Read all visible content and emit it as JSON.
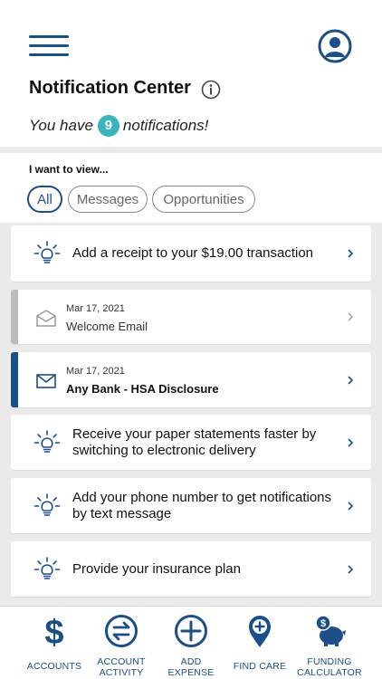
{
  "header": {
    "title": "Notification Center",
    "subtitle_prefix": "You have",
    "count": "9",
    "subtitle_suffix": "notifications!"
  },
  "filter": {
    "label": "I want to view...",
    "chips": [
      {
        "label": "All",
        "active": true
      },
      {
        "label": "Messages",
        "active": false
      },
      {
        "label": "Opportunities",
        "active": false
      }
    ]
  },
  "notifications": [
    {
      "type": "opportunity",
      "text": "Add a receipt to your $19.00 transaction"
    },
    {
      "type": "message",
      "date": "Mar 17, 2021",
      "title": "Welcome Email",
      "read": true
    },
    {
      "type": "message",
      "date": "Mar 17, 2021",
      "title": "Any Bank - HSA Disclosure",
      "read": false
    },
    {
      "type": "opportunity",
      "text": "Receive your paper statements faster by switching to electronic delivery"
    },
    {
      "type": "opportunity",
      "text": "Add your phone number to get notifications by text message"
    },
    {
      "type": "opportunity",
      "text": "Provide your insurance plan"
    }
  ],
  "tabs": [
    {
      "label_1": "ACCOUNTS",
      "label_2": "",
      "icon": "dollar-icon"
    },
    {
      "label_1": "ACCOUNT",
      "label_2": "ACTIVITY",
      "icon": "exchange-icon"
    },
    {
      "label_1": "ADD",
      "label_2": "EXPENSE",
      "icon": "plus-circle-icon"
    },
    {
      "label_1": "FIND CARE",
      "label_2": "",
      "icon": "map-pin-plus-icon"
    },
    {
      "label_1": "FUNDING",
      "label_2": "CALCULATOR",
      "icon": "piggy-bank-icon"
    }
  ],
  "colors": {
    "primary": "#1a4f8a",
    "badge": "#3bb4be",
    "unread_stripe": "#1a4f8a",
    "read_stripe": "#bdbdbd",
    "background": "#eaeaea"
  }
}
